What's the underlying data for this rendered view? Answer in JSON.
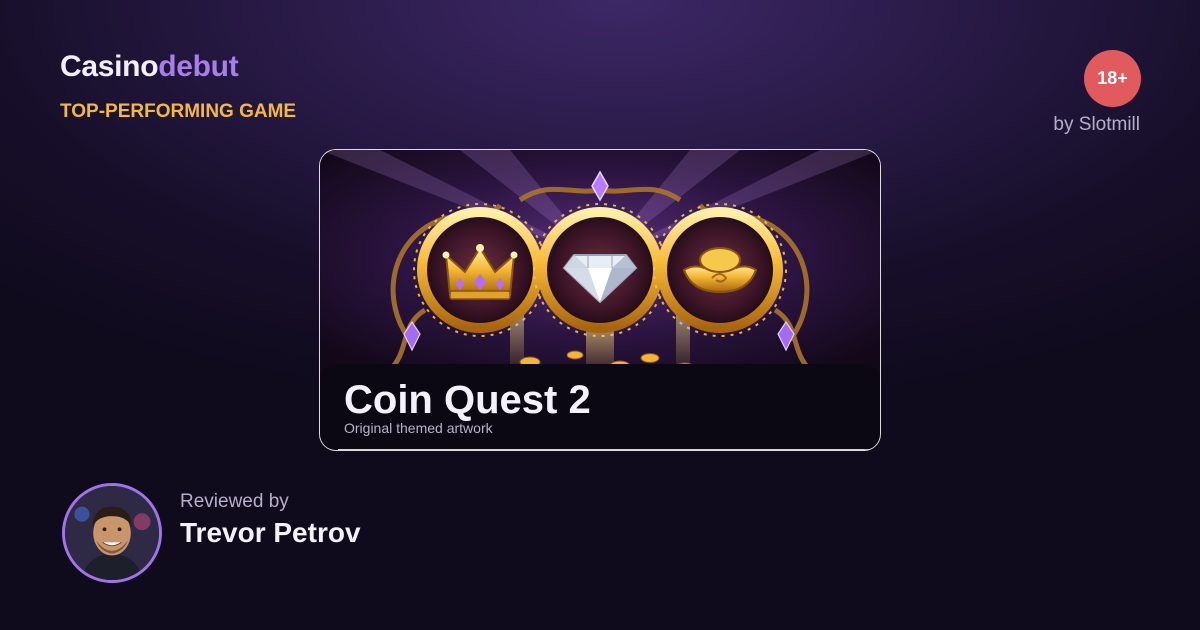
{
  "header": {
    "brand_part1": "Casino",
    "brand_part2": "debut",
    "tagline": "TOP-PERFORMING GAME",
    "age_badge": "18+",
    "provider_line": "by Slotmill"
  },
  "game": {
    "title": "Coin Quest 2",
    "subtitle": "Original themed artwork",
    "artwork_icons": [
      "crown-icon",
      "diamond-icon",
      "gold-ingot-icon"
    ]
  },
  "review": {
    "label": "Reviewed by",
    "name": "Trevor Petrov"
  },
  "colors": {
    "brand_accent": "#a77fe8",
    "tagline": "#f2b840",
    "age_badge": "#e05a5e",
    "avatar_ring": "#a074e6"
  }
}
